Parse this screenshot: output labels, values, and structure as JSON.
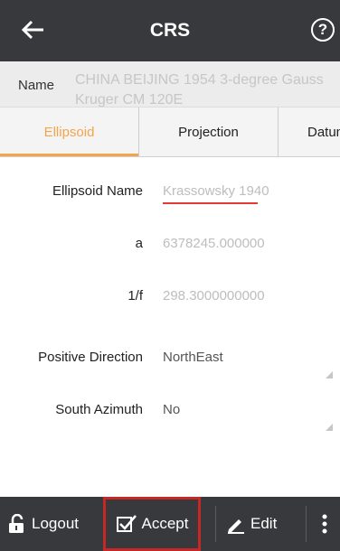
{
  "header": {
    "title": "CRS",
    "back_icon": "back-arrow-icon",
    "help_icon": "help-icon",
    "help_glyph": "?"
  },
  "name_field": {
    "label": "Name",
    "value": "CHINA BEIJING 1954 3-degree Gauss Kruger CM 120E"
  },
  "tabs": [
    {
      "label": "Ellipsoid",
      "active": true
    },
    {
      "label": "Projection",
      "active": false
    },
    {
      "label": "Datum",
      "active": false
    }
  ],
  "form": {
    "ellipsoid_name": {
      "label": "Ellipsoid Name",
      "value": "Krassowsky 1940"
    },
    "a": {
      "label": "a",
      "value": "6378245.000000"
    },
    "inv_f": {
      "label": "1/f",
      "value": "298.3000000000"
    },
    "positive_direction": {
      "label": "Positive Direction",
      "value": "NorthEast"
    },
    "south_azimuth": {
      "label": "South Azimuth",
      "value": "No"
    }
  },
  "toolbar": {
    "logout_label": "Logout",
    "accept_label": "Accept",
    "edit_label": "Edit",
    "more_icon": "more-vertical-icon"
  },
  "colors": {
    "appbar": "#37393d",
    "accent_tab": "#f2a54a",
    "highlight_border": "#c62828",
    "spellcheck_underline": "#e53935"
  }
}
